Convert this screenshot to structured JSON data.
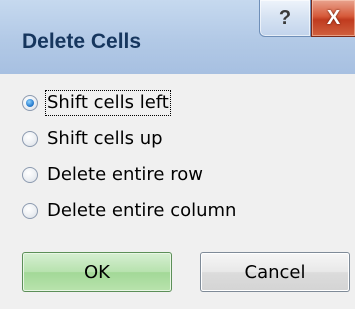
{
  "window": {
    "title": "Delete Cells",
    "help_glyph": "?",
    "close_glyph": "X"
  },
  "options": [
    {
      "label": "Shift cells left",
      "selected": true
    },
    {
      "label": "Shift cells up",
      "selected": false
    },
    {
      "label": "Delete entire row",
      "selected": false
    },
    {
      "label": "Delete entire column",
      "selected": false
    }
  ],
  "buttons": {
    "ok_label": "OK",
    "cancel_label": "Cancel"
  },
  "colors": {
    "title_text": "#16365e",
    "titlebar": "#b2c9e6",
    "close_button": "#d65a3a",
    "ok_button": "#b7e2ae",
    "radio_selected": "#2b7fd0"
  }
}
